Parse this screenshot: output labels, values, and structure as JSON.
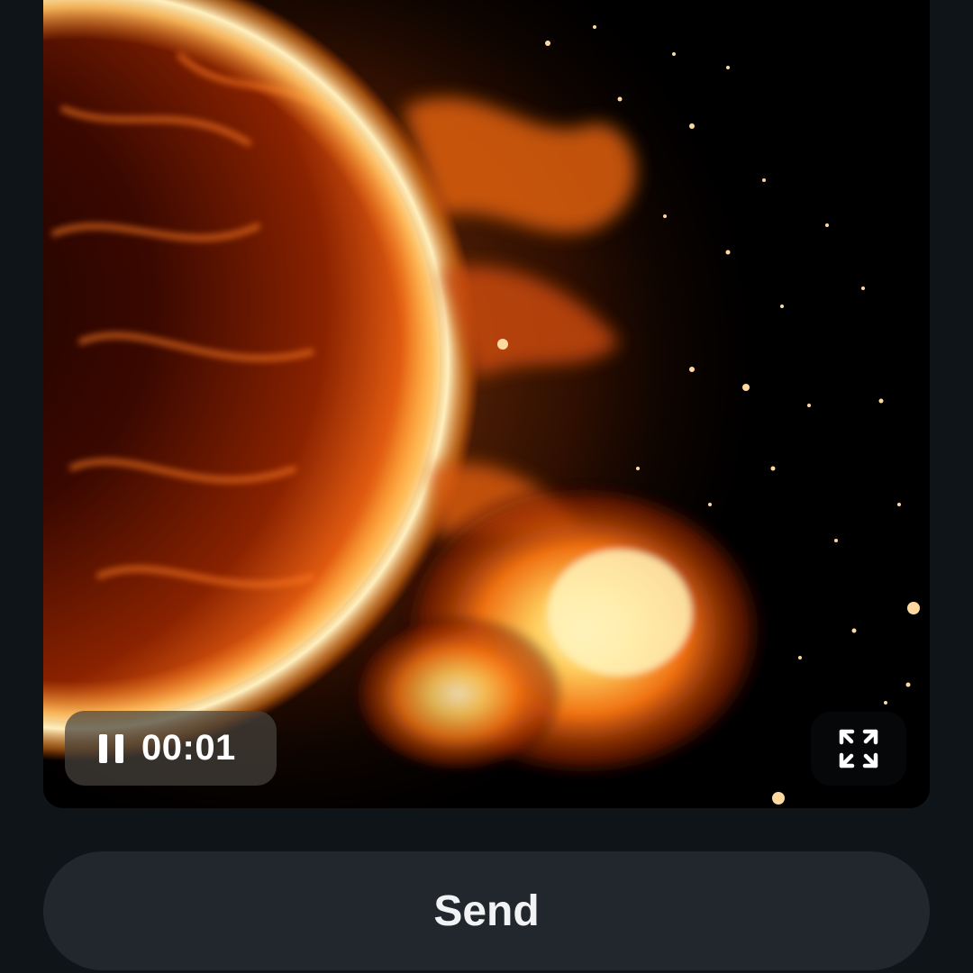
{
  "video": {
    "timecode": "00:01",
    "state": "playing",
    "controls": {
      "pause_icon": "pause-icon",
      "fullscreen_icon": "expand-arrows-icon"
    }
  },
  "actions": {
    "send_label": "Send"
  },
  "colors": {
    "page_background": "#0f1419",
    "button_background": "#22272e",
    "button_text": "#f2f3f5",
    "overlay_text": "#ffffff"
  }
}
